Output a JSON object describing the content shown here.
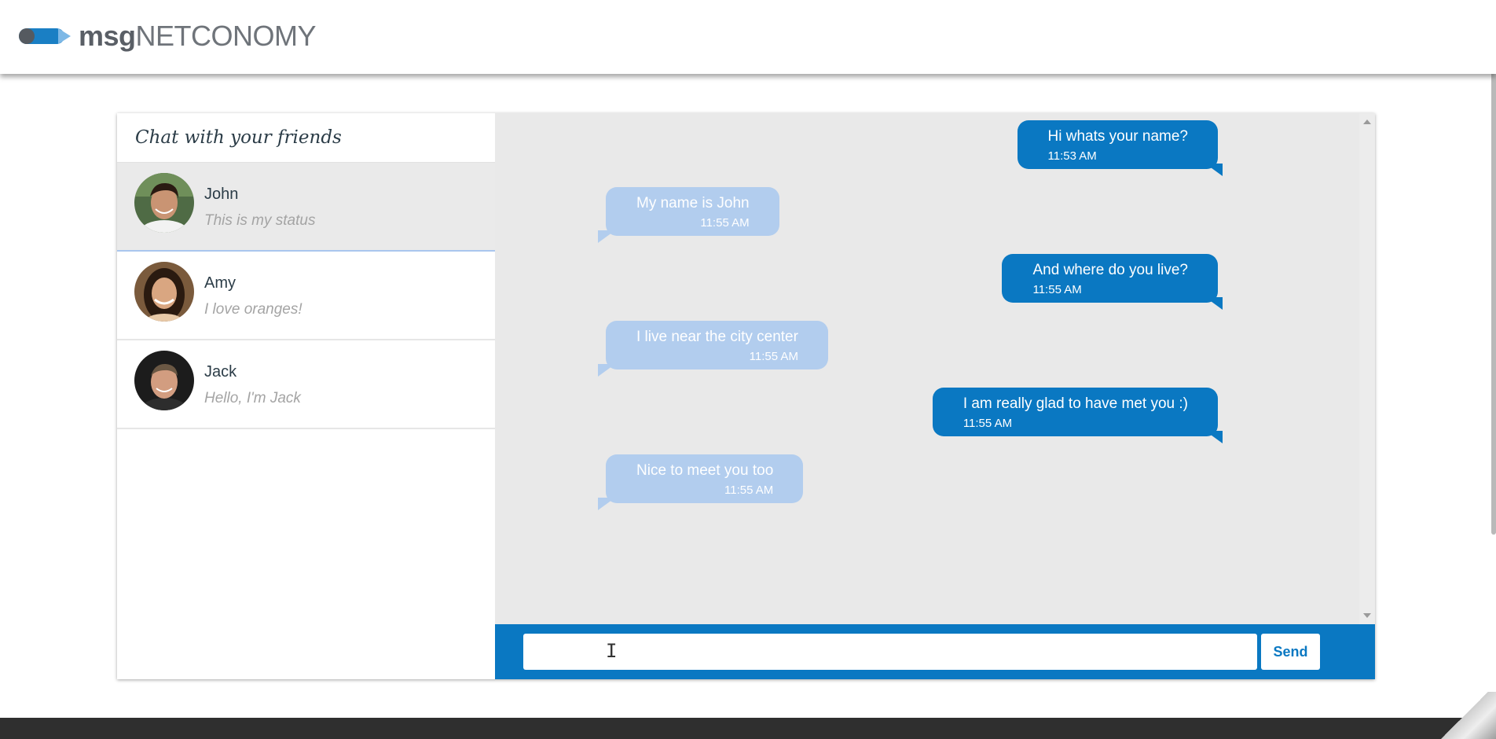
{
  "header": {
    "logo_bold": "msg",
    "logo_light": "NETCONOMY"
  },
  "sidebar": {
    "title": "Chat with your friends",
    "friends": [
      {
        "name": "John",
        "status": "This is my status",
        "active": true
      },
      {
        "name": "Amy",
        "status": "I love oranges!",
        "active": false
      },
      {
        "name": "Jack",
        "status": "Hello, I'm Jack",
        "active": false
      }
    ]
  },
  "chat": {
    "messages": [
      {
        "direction": "sent",
        "text": "Hi whats your name?",
        "time": "11:53 AM"
      },
      {
        "direction": "received",
        "text": "My name is John",
        "time": "11:55 AM"
      },
      {
        "direction": "sent",
        "text": "And where do you live?",
        "time": "11:55 AM"
      },
      {
        "direction": "received",
        "text": "I live near the city center",
        "time": "11:55 AM"
      },
      {
        "direction": "sent",
        "text": "I am really glad to have met you :)",
        "time": "11:55 AM"
      },
      {
        "direction": "received",
        "text": "Nice to meet you too",
        "time": "11:55 AM"
      }
    ],
    "input": {
      "value": "",
      "placeholder": ""
    },
    "send_label": "Send"
  },
  "colors": {
    "accent": "#0a78c2",
    "received_bubble": "#b2cdee",
    "chat_background": "#e9e9e9",
    "footer": "#2f2f2f"
  },
  "icons": [
    "logo-mark",
    "scroll-up-arrow",
    "scroll-down-arrow",
    "text-cursor"
  ]
}
